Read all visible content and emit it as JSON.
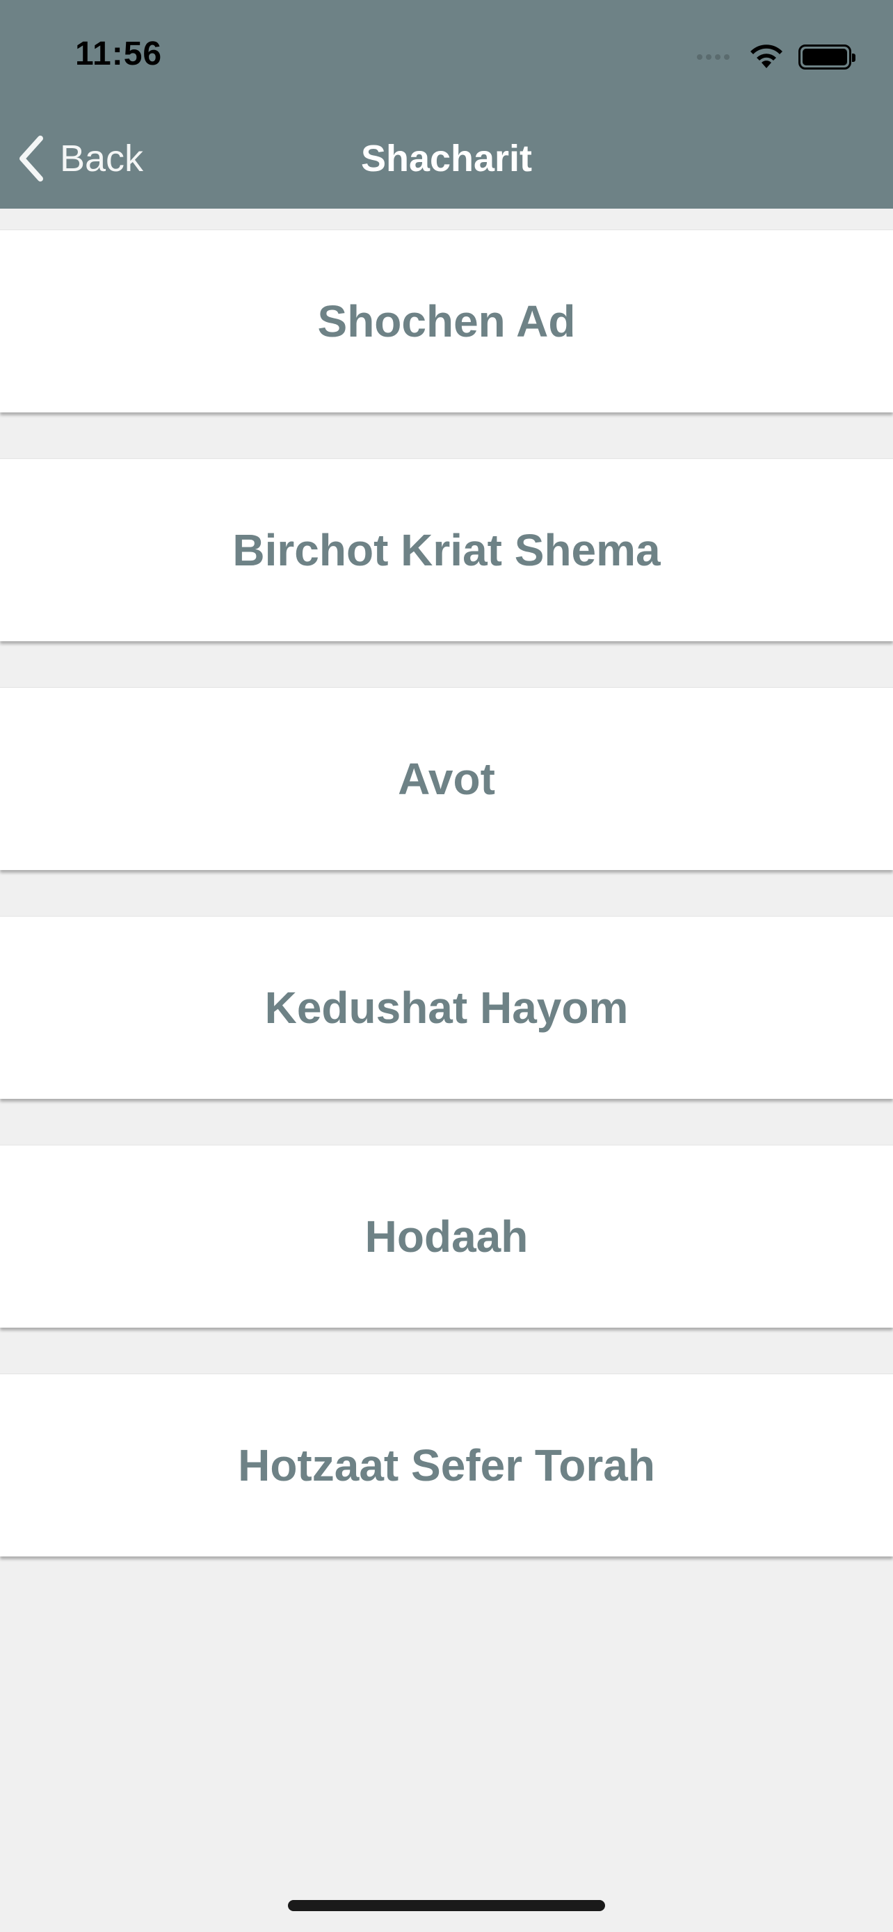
{
  "status_bar": {
    "time": "11:56",
    "icons": [
      "cellular-signal-icon",
      "wifi-icon",
      "battery-icon"
    ]
  },
  "nav": {
    "back_label": "Back",
    "title": "Shacharit"
  },
  "items": [
    {
      "label": "Shochen Ad"
    },
    {
      "label": "Birchot Kriat Shema"
    },
    {
      "label": "Avot"
    },
    {
      "label": "Kedushat Hayom"
    },
    {
      "label": "Hodaah"
    },
    {
      "label": "Hotzaat Sefer Torah"
    }
  ],
  "colors": {
    "header_background": "#6e8286",
    "item_text": "#6e8286",
    "page_background": "#f0f0f0",
    "item_background": "#ffffff"
  }
}
